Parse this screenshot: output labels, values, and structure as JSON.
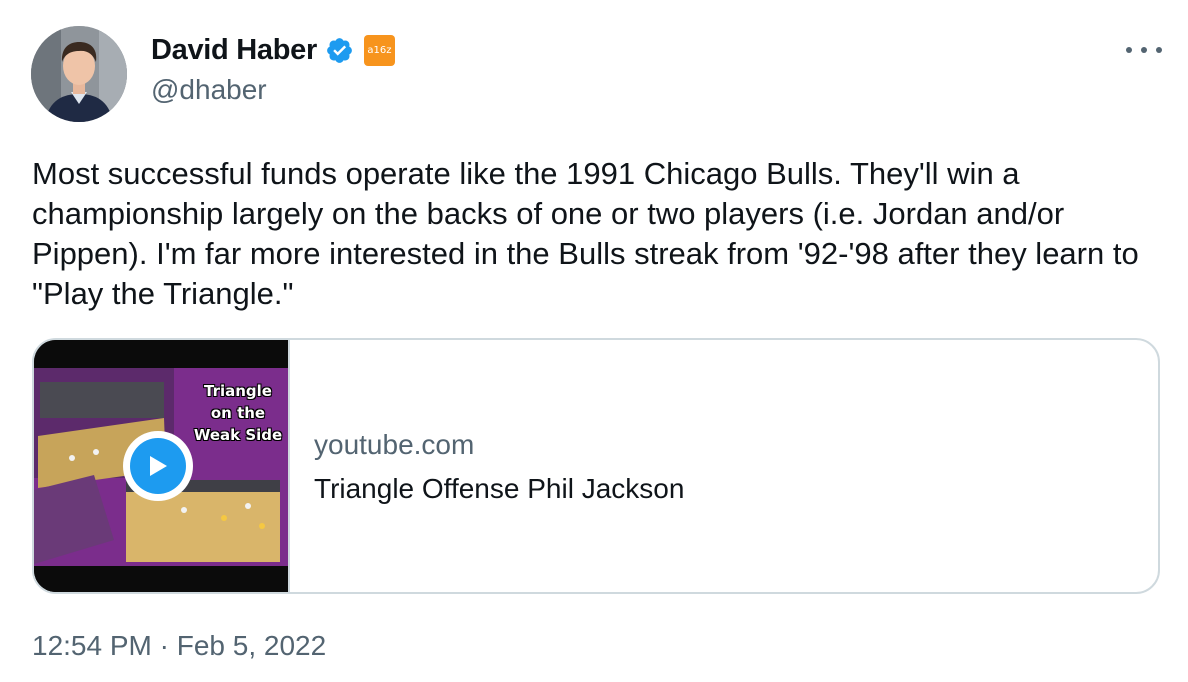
{
  "tweet": {
    "author": {
      "display_name": "David Haber",
      "handle": "@dhaber",
      "affiliation_badge_text": "a16z",
      "verified_color": "#1d9bf0",
      "badge_color": "#f7941d"
    },
    "text": "Most successful funds operate like the 1991 Chicago Bulls. They'll win a championship largely on the backs of one or two players (i.e. Jordan and/or Pippen). I'm far more interested in the Bulls streak from '92-'98 after they learn to \"Play the Triangle.\"",
    "card": {
      "thumbnail_caption": "Triangle\non the\nWeak Side",
      "domain": "youtube.com",
      "title": "Triangle Offense Phil Jackson"
    },
    "timestamp": "12:54 PM · Feb 5, 2022",
    "icons": {
      "more": "more-options-icon",
      "verified": "verified-badge-icon",
      "play": "play-icon"
    }
  }
}
